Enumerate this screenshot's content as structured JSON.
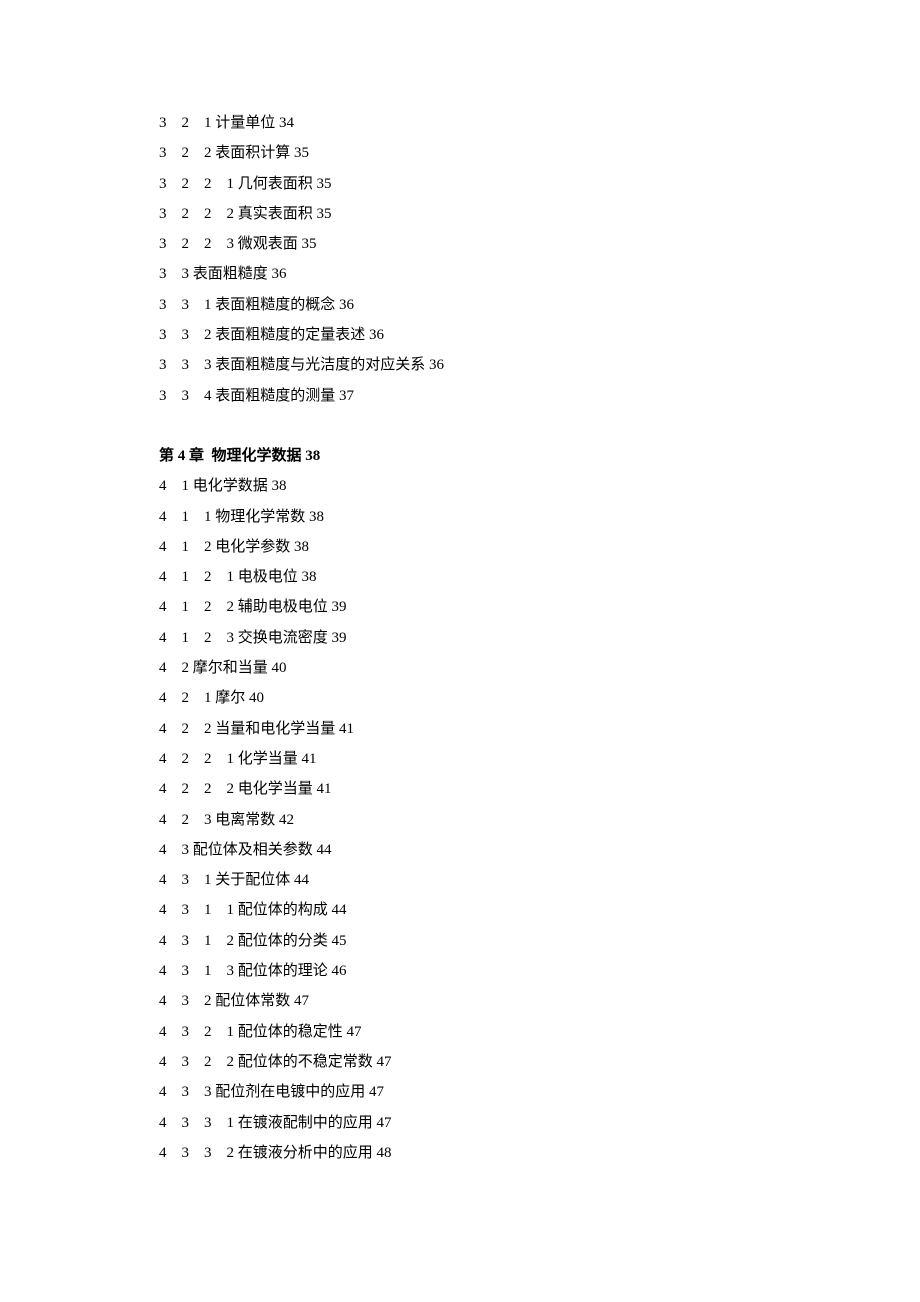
{
  "section3_tail": [
    {
      "nums": "3　2　1",
      "title": "计量单位",
      "page": "34"
    },
    {
      "nums": "3　2　2",
      "title": "表面积计算",
      "page": "35"
    },
    {
      "nums": "3　2　2　1",
      "title": "几何表面积",
      "page": "35"
    },
    {
      "nums": "3　2　2　2",
      "title": "真实表面积",
      "page": "35"
    },
    {
      "nums": "3　2　2　3",
      "title": "微观表面",
      "page": "35"
    },
    {
      "nums": "3　3",
      "title": "表面粗糙度",
      "page": "36"
    },
    {
      "nums": "3　3　1",
      "title": "表面粗糙度的概念",
      "page": "36"
    },
    {
      "nums": "3　3　2",
      "title": "表面粗糙度的定量表述",
      "page": "36"
    },
    {
      "nums": "3　3　3",
      "title": "表面粗糙度与光洁度的对应关系",
      "page": "36"
    },
    {
      "nums": "3　3　4",
      "title": "表面粗糙度的测量",
      "page": "37"
    }
  ],
  "chapter4": {
    "heading_prefix": "第",
    "heading_num": "4",
    "heading_mid": "章  物理化学数据",
    "heading_page": "38",
    "entries": [
      {
        "nums": "4　1",
        "title": "电化学数据",
        "page": "38"
      },
      {
        "nums": "4　1　1",
        "title": "物理化学常数",
        "page": "38"
      },
      {
        "nums": "4　1　2",
        "title": "电化学参数",
        "page": "38"
      },
      {
        "nums": "4　1　2　1",
        "title": "电极电位",
        "page": "38"
      },
      {
        "nums": "4　1　2　2",
        "title": "辅助电极电位",
        "page": "39"
      },
      {
        "nums": "4　1　2　3",
        "title": "交换电流密度",
        "page": "39"
      },
      {
        "nums": "4　2",
        "title": "摩尔和当量",
        "page": "40"
      },
      {
        "nums": "4　2　1",
        "title": "摩尔",
        "page": "40"
      },
      {
        "nums": "4　2　2",
        "title": "当量和电化学当量",
        "page": "41"
      },
      {
        "nums": "4　2　2　1",
        "title": "化学当量",
        "page": "41"
      },
      {
        "nums": "4　2　2　2",
        "title": "电化学当量",
        "page": "41"
      },
      {
        "nums": "4　2　3",
        "title": "电离常数",
        "page": "42"
      },
      {
        "nums": "4　3",
        "title": "配位体及相关参数",
        "page": "44"
      },
      {
        "nums": "4　3　1",
        "title": "关于配位体",
        "page": "44"
      },
      {
        "nums": "4　3　1　1",
        "title": "配位体的构成",
        "page": "44"
      },
      {
        "nums": "4　3　1　2",
        "title": "配位体的分类",
        "page": "45"
      },
      {
        "nums": "4　3　1　3",
        "title": "配位体的理论",
        "page": "46"
      },
      {
        "nums": "4　3　2",
        "title": "配位体常数",
        "page": "47"
      },
      {
        "nums": "4　3　2　1",
        "title": "配位体的稳定性",
        "page": "47"
      },
      {
        "nums": "4　3　2　2",
        "title": "配位体的不稳定常数",
        "page": "47"
      },
      {
        "nums": "4　3　3",
        "title": "配位剂在电镀中的应用",
        "page": "47"
      },
      {
        "nums": "4　3　3　1",
        "title": "在镀液配制中的应用",
        "page": "47"
      },
      {
        "nums": "4　3　3　2",
        "title": "在镀液分析中的应用",
        "page": "48"
      }
    ]
  }
}
